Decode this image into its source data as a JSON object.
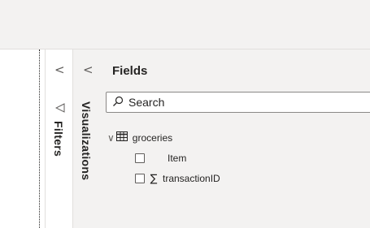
{
  "panes": {
    "filters": {
      "label": "Filters",
      "collapse_glyph": "<",
      "icon": "filter-icon"
    },
    "visualizations": {
      "label": "Visualizations",
      "collapse_glyph": "<"
    },
    "fields": {
      "title": "Fields",
      "search": {
        "placeholder": "Search",
        "value": ""
      },
      "tables": [
        {
          "name": "groceries",
          "expanded": true,
          "fields": [
            {
              "name": "Item",
              "aggregate": false
            },
            {
              "name": "transactionID",
              "aggregate": true,
              "icon": "sigma-icon"
            }
          ]
        }
      ]
    }
  },
  "colors": {
    "pane_bg": "#f3f2f1",
    "border": "#e1dfdd",
    "text": "#252423"
  }
}
